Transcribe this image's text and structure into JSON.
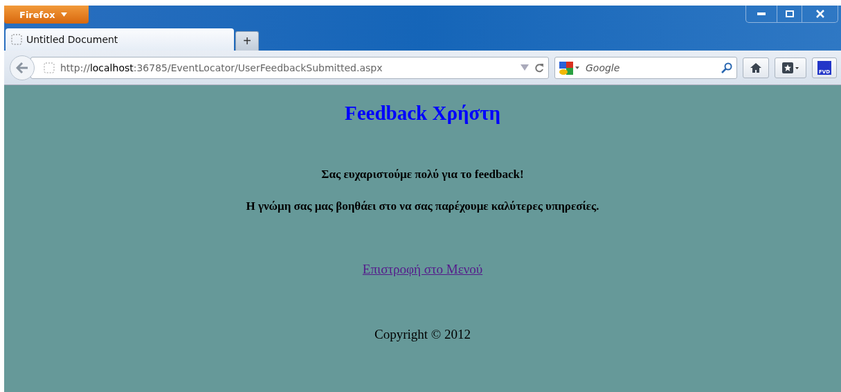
{
  "browser": {
    "menu_button": "Firefox",
    "tabs": [
      {
        "label": "Untitled Document",
        "selected": true
      }
    ],
    "new_tab": "+",
    "url": "http://**localhost**:36785/EventLocator/UserFeedbackSubmitted.aspx",
    "search": {
      "placeholder": "Google"
    },
    "extension": "FVD"
  },
  "page": {
    "title": "Feedback Χρήστη",
    "messages": [
      "Σας ευχαριστούμε πολύ για το feedback!",
      "Η γνώμη σας μας βοηθάει στο να σας παρέχουμε καλύτερες υπηρεσίες."
    ],
    "link": "Επιστροφή στο Μενού",
    "footer": "Copyright © 2012"
  }
}
